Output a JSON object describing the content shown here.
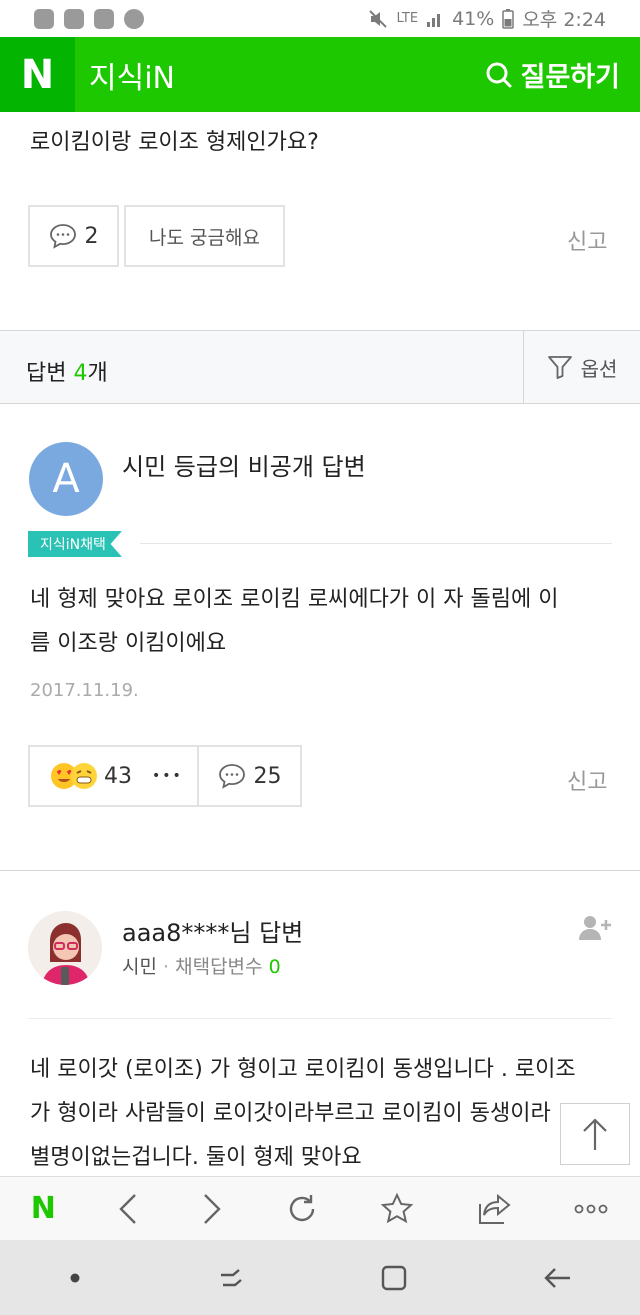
{
  "status_bar": {
    "network": "LTE",
    "battery": "41%",
    "time": "오후 2:24"
  },
  "header": {
    "logo": "N",
    "title": "지식iN",
    "ask_label": "질문하기"
  },
  "question": {
    "text": "로이킴이랑 로이조 형제인가요?",
    "comment_count": "2",
    "curious_label": "나도 궁금해요",
    "report_label": "신고"
  },
  "answers_header": {
    "label": "답변",
    "count": "4",
    "unit": "개",
    "options_label": "옵션"
  },
  "answer1": {
    "avatar_letter": "A",
    "title": "시민 등급의 비공개 답변",
    "badge": "지식iN채택",
    "body_line1": "네 형제 맞아요 로이조 로이킴 로씨에다가 이 자 돌림에 이",
    "body_line2": "름 이조랑 이킴이에요",
    "date": "2017.11.19.",
    "reaction_count": "43",
    "more_label": "•••",
    "comment_count": "25",
    "report_label": "신고"
  },
  "answer2": {
    "title": "aaa8****님 답변",
    "rank": "시민",
    "dot": "·",
    "adopt_label": "채택답변수",
    "adopt_count": "0",
    "body_line1": "네 로이갓 (로이조) 가 형이고 로이킴이 동생입니다 . 로이조",
    "body_line2": "가 형이라 사람들이 로이갓이라부르고 로이킴이 동생이라",
    "body_line3": "별명이없는겁니다. 둘이 형제 맞아요"
  },
  "browser_nav": {
    "home": "N"
  },
  "colors": {
    "brand_green": "#1ec800",
    "badge_teal": "#29c2b4",
    "avatar_blue": "#7aa9e0"
  },
  "icons": [
    "search-icon",
    "comment-icon",
    "filter-icon",
    "follow-icon",
    "arrow-up-icon",
    "back-icon",
    "forward-icon",
    "refresh-icon",
    "star-icon",
    "share-icon",
    "more-icon"
  ]
}
